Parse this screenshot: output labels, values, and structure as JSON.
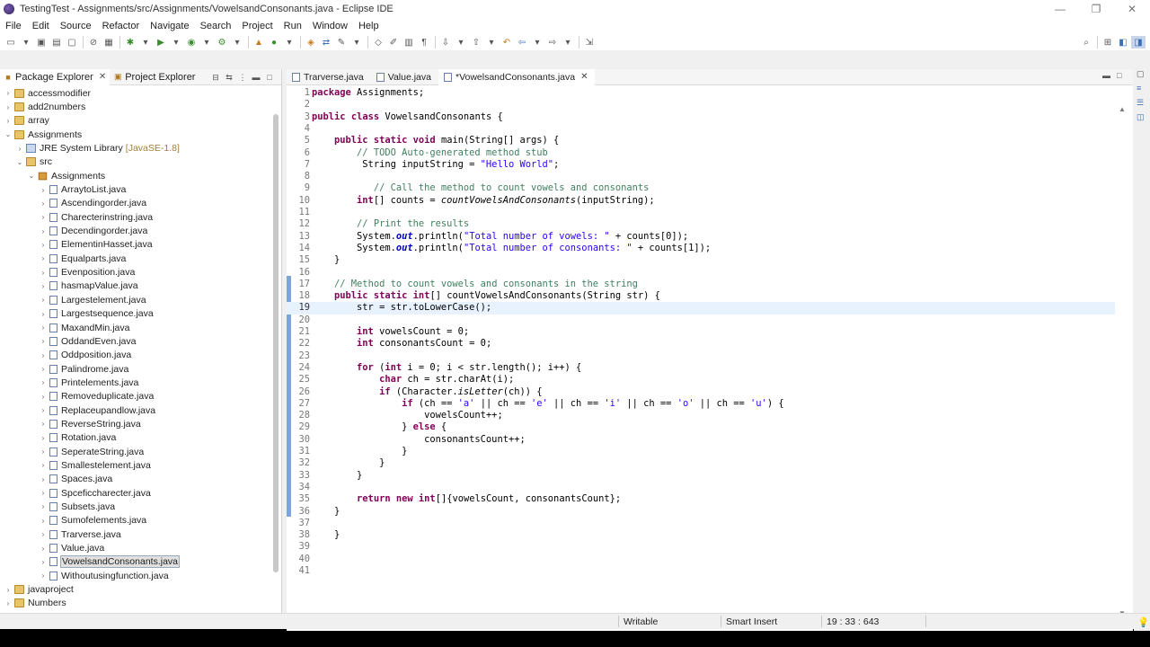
{
  "window": {
    "title": "TestingTest - Assignments/src/Assignments/VowelsandConsonants.java - Eclipse IDE",
    "controls": [
      "—",
      "❐",
      "✕"
    ]
  },
  "menu": [
    "File",
    "Edit",
    "Source",
    "Refactor",
    "Navigate",
    "Search",
    "Project",
    "Run",
    "Window",
    "Help"
  ],
  "left_panel": {
    "tabs": [
      {
        "label": "Package Explorer",
        "active": true
      },
      {
        "label": "Project Explorer",
        "active": false
      }
    ],
    "tree": [
      {
        "depth": 0,
        "arrow": "›",
        "icon": "proj",
        "label": "accessmodifier"
      },
      {
        "depth": 0,
        "arrow": "›",
        "icon": "proj",
        "label": "add2numbers"
      },
      {
        "depth": 0,
        "arrow": "›",
        "icon": "proj",
        "label": "array"
      },
      {
        "depth": 0,
        "arrow": "⌄",
        "icon": "proj",
        "label": "Assignments"
      },
      {
        "depth": 1,
        "arrow": "›",
        "icon": "lib",
        "label": "JRE System Library",
        "decoration": "[JavaSE-1.8]"
      },
      {
        "depth": 1,
        "arrow": "⌄",
        "icon": "src",
        "label": "src"
      },
      {
        "depth": 2,
        "arrow": "⌄",
        "icon": "pkg",
        "label": "Assignments"
      },
      {
        "depth": 3,
        "arrow": "›",
        "icon": "java",
        "label": "ArraytoList.java"
      },
      {
        "depth": 3,
        "arrow": "›",
        "icon": "java",
        "label": "Ascendingorder.java"
      },
      {
        "depth": 3,
        "arrow": "›",
        "icon": "java",
        "label": "Charecterinstring.java"
      },
      {
        "depth": 3,
        "arrow": "›",
        "icon": "java",
        "label": "Decendingorder.java"
      },
      {
        "depth": 3,
        "arrow": "›",
        "icon": "java",
        "label": "ElementinHasset.java"
      },
      {
        "depth": 3,
        "arrow": "›",
        "icon": "java",
        "label": "Equalparts.java"
      },
      {
        "depth": 3,
        "arrow": "›",
        "icon": "java",
        "label": "Evenposition.java"
      },
      {
        "depth": 3,
        "arrow": "›",
        "icon": "java",
        "label": "hasmapValue.java"
      },
      {
        "depth": 3,
        "arrow": "›",
        "icon": "java",
        "label": "Largestelement.java"
      },
      {
        "depth": 3,
        "arrow": "›",
        "icon": "java",
        "label": "Largestsequence.java"
      },
      {
        "depth": 3,
        "arrow": "›",
        "icon": "java",
        "label": "MaxandMin.java"
      },
      {
        "depth": 3,
        "arrow": "›",
        "icon": "java",
        "label": "OddandEven.java"
      },
      {
        "depth": 3,
        "arrow": "›",
        "icon": "java",
        "label": "Oddposition.java"
      },
      {
        "depth": 3,
        "arrow": "›",
        "icon": "java",
        "label": "Palindrome.java"
      },
      {
        "depth": 3,
        "arrow": "›",
        "icon": "java",
        "label": "Printelements.java"
      },
      {
        "depth": 3,
        "arrow": "›",
        "icon": "java",
        "label": "Removeduplicate.java"
      },
      {
        "depth": 3,
        "arrow": "›",
        "icon": "java",
        "label": "Replaceupandlow.java"
      },
      {
        "depth": 3,
        "arrow": "›",
        "icon": "java",
        "label": "ReverseString.java"
      },
      {
        "depth": 3,
        "arrow": "›",
        "icon": "java",
        "label": "Rotation.java"
      },
      {
        "depth": 3,
        "arrow": "›",
        "icon": "java",
        "label": "SeperateString.java"
      },
      {
        "depth": 3,
        "arrow": "›",
        "icon": "java",
        "label": "Smallestelement.java"
      },
      {
        "depth": 3,
        "arrow": "›",
        "icon": "java",
        "label": "Spaces.java"
      },
      {
        "depth": 3,
        "arrow": "›",
        "icon": "java",
        "label": "Spceficcharecter.java"
      },
      {
        "depth": 3,
        "arrow": "›",
        "icon": "java",
        "label": "Subsets.java"
      },
      {
        "depth": 3,
        "arrow": "›",
        "icon": "java",
        "label": "Sumofelements.java"
      },
      {
        "depth": 3,
        "arrow": "›",
        "icon": "java",
        "label": "Trarverse.java"
      },
      {
        "depth": 3,
        "arrow": "›",
        "icon": "java",
        "label": "Value.java"
      },
      {
        "depth": 3,
        "arrow": "›",
        "icon": "java",
        "label": "VowelsandConsonants.java",
        "selected": true
      },
      {
        "depth": 3,
        "arrow": "›",
        "icon": "java",
        "label": "Withoutusingfunction.java"
      },
      {
        "depth": 0,
        "arrow": "›",
        "icon": "proj",
        "label": "javaproject"
      },
      {
        "depth": 0,
        "arrow": "›",
        "icon": "proj",
        "label": "Numbers"
      }
    ]
  },
  "editor": {
    "tabs": [
      {
        "label": "Trarverse.java",
        "active": false
      },
      {
        "label": "Value.java",
        "active": false
      },
      {
        "label": "*VowelsandConsonants.java",
        "active": true
      }
    ],
    "current_line": 19,
    "lines": [
      "<span class='kw'>package</span> Assignments;",
      "",
      "<span class='kw'>public</span> <span class='kw'>class</span> VowelsandConsonants {",
      "",
      "    <span class='kw'>public</span> <span class='kw'>static</span> <span class='kw'>void</span> main(String[] args) {",
      "        <span class='cm'>// TODO Auto-generated method stub</span>",
      "         String inputString = <span class='st'>\"Hello World\"</span>;",
      "",
      "           <span class='cm'>// Call the method to count vowels and consonants</span>",
      "        <span class='kw'>int</span>[] counts = <span class='it'>countVowelsAndConsonants</span>(inputString);",
      "",
      "        <span class='cm'>// Print the results</span>",
      "        System.<span class='fld'>out</span>.println(<span class='st'>\"Total number of vowels: \"</span> + counts[0]);",
      "        System.<span class='fld'>out</span>.println(<span class='st'>\"Total number of consonants: \"</span> + counts[1]);",
      "    }",
      "",
      "    <span class='cm'>// Method to count vowels and consonants in the string</span>",
      "    <span class='kw'>public</span> <span class='kw'>static</span> <span class='kw'>int</span>[] countVowelsAndConsonants(String str) {",
      "        str = str.toLowerCase();",
      "",
      "        <span class='kw'>int</span> vowelsCount = 0;",
      "        <span class='kw'>int</span> consonantsCount = 0;",
      "",
      "        <span class='kw'>for</span> (<span class='kw'>int</span> i = 0; i &lt; str.length(); i++) {",
      "            <span class='kw'>char</span> ch = str.charAt(i);",
      "            <span class='kw'>if</span> (Character.<span class='it'>isLetter</span>(ch)) {",
      "                <span class='kw'>if</span> (ch == <span class='st'>'a'</span> || ch == <span class='st'>'e'</span> || ch == <span class='st'>'i'</span> || ch == <span class='st'>'o'</span> || ch == <span class='st'>'u'</span>) {",
      "                    vowelsCount++;",
      "                } <span class='kw'>else</span> {",
      "                    consonantsCount++;",
      "                }",
      "            }",
      "        }",
      "",
      "        <span class='kw'>return</span> <span class='kw'>new</span> <span class='kw'>int</span>[]{vowelsCount, consonantsCount};",
      "    }",
      "",
      "    }",
      "",
      "",
      ""
    ]
  },
  "status": {
    "writable": "Writable",
    "insert_mode": "Smart Insert",
    "position": "19 : 33 : 643"
  }
}
